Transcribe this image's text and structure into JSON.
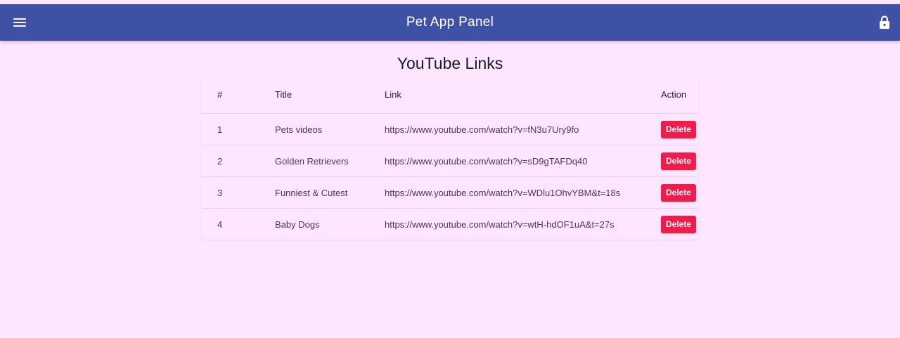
{
  "colors": {
    "appbar": "#3f51a5",
    "background": "#fde6ff",
    "delete_button": "#f11b4c"
  },
  "header": {
    "title": "Pet App Panel",
    "menu_icon": "menu-icon",
    "lock_icon": "lock-icon"
  },
  "main": {
    "heading": "YouTube Links",
    "table": {
      "columns": [
        "#",
        "Title",
        "Link",
        "Action"
      ],
      "rows": [
        {
          "num": "1",
          "title": "Pets videos",
          "link": "https://www.youtube.com/watch?v=fN3u7Ury9fo",
          "action": "Delete"
        },
        {
          "num": "2",
          "title": "Golden Retrievers",
          "link": "https://www.youtube.com/watch?v=sD9gTAFDq40",
          "action": "Delete"
        },
        {
          "num": "3",
          "title": "Funniest & Cutest",
          "link": "https://www.youtube.com/watch?v=WDlu1OhvYBM&t=18s",
          "action": "Delete"
        },
        {
          "num": "4",
          "title": "Baby Dogs",
          "link": "https://www.youtube.com/watch?v=wtH-hdOF1uA&t=27s",
          "action": "Delete"
        }
      ]
    }
  }
}
